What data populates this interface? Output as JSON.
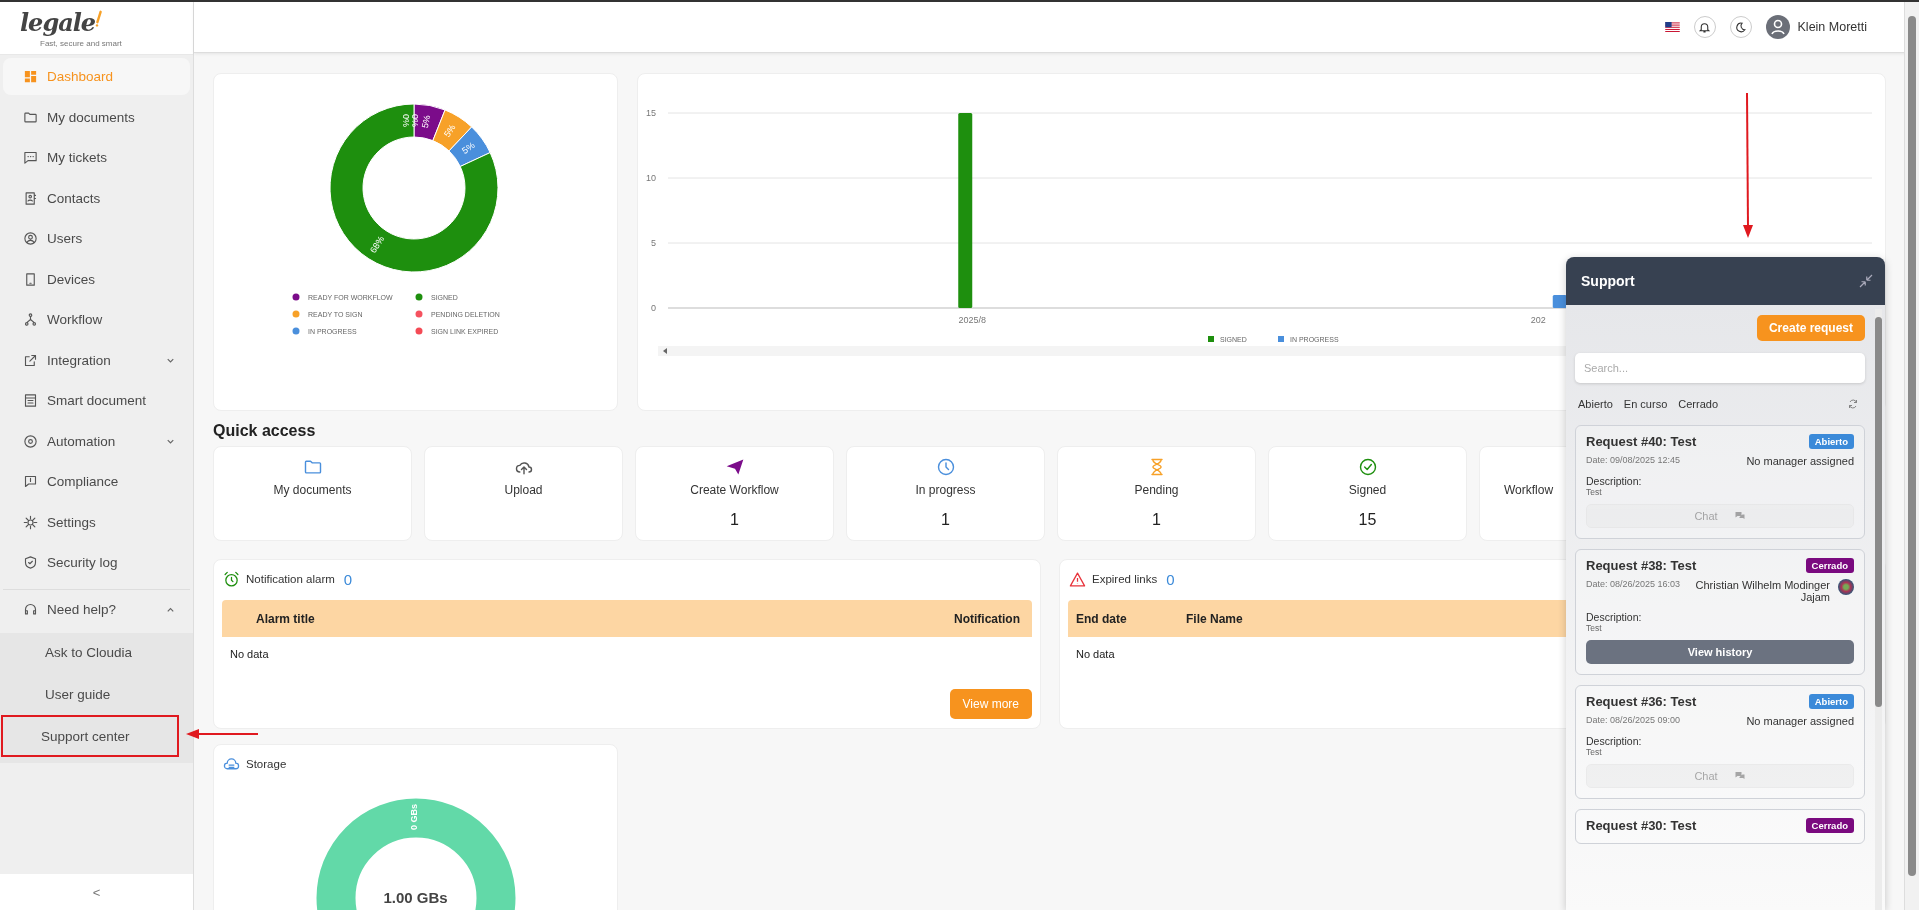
{
  "sidebar": {
    "logo": {
      "wordmark": "legale",
      "tagline": "Fast, secure and smart"
    },
    "items": [
      {
        "label": "Dashboard",
        "selected": true
      },
      {
        "label": "My documents",
        "selected": false
      },
      {
        "label": "My tickets",
        "selected": false
      },
      {
        "label": "Contacts",
        "selected": false
      },
      {
        "label": "Users",
        "selected": false
      },
      {
        "label": "Devices",
        "selected": false
      },
      {
        "label": "Workflow",
        "selected": false
      },
      {
        "label": "Integration",
        "selected": false,
        "expanded": false
      },
      {
        "label": "Smart document",
        "selected": false
      },
      {
        "label": "Automation",
        "selected": false,
        "expanded": false
      },
      {
        "label": "Compliance",
        "selected": false
      },
      {
        "label": "Settings",
        "selected": false
      },
      {
        "label": "Security log",
        "selected": false
      },
      {
        "label": "Need help?",
        "selected": false,
        "expanded": true,
        "children": [
          {
            "label": "Ask to Cloudia",
            "selected": false,
            "annotated": false
          },
          {
            "label": "User guide",
            "selected": false,
            "annotated": false
          },
          {
            "label": "Support center",
            "selected": false,
            "annotated": true
          }
        ]
      }
    ],
    "collapse": "<"
  },
  "header": {
    "user_name": "Klein Moretti"
  },
  "status_chart": {
    "chart_data": {
      "type": "donut",
      "categories": [
        "READY FOR WORKFLOW",
        "READY TO SIGN",
        "IN PROGRESS",
        "SIGNED",
        "PENDING DELETION",
        "SIGN LINK EXPIRED"
      ],
      "values": [
        5,
        5,
        5,
        68,
        0,
        0
      ],
      "colors": [
        "#7b0c8a",
        "#f7a128",
        "#4a8fdc",
        "#1e8f0e",
        "#f5525f",
        "#f44a55"
      ],
      "value_labels": [
        "5%",
        "5%",
        "5%",
        "68%",
        "0%",
        "0%"
      ],
      "legend": true
    }
  },
  "activity_chart": {
    "chart_data": {
      "type": "bar",
      "categories": [
        "2025/8",
        "202"
      ],
      "series": [
        {
          "name": "SIGNED",
          "color": "#1e8f0e",
          "values": [
            15,
            0
          ]
        },
        {
          "name": "IN PROGRESS",
          "color": "#4a8fdc",
          "values": [
            0,
            1
          ]
        }
      ],
      "ylim": [
        0,
        15
      ],
      "yticks": [
        0,
        5,
        10,
        15
      ],
      "legend": true
    }
  },
  "quick_access": {
    "title": "Quick access",
    "tiles": [
      {
        "label": "My documents",
        "icon": true
      },
      {
        "label": "Upload",
        "icon": true
      },
      {
        "label": "Create Workflow",
        "icon": true,
        "count": "1"
      },
      {
        "label": "In progress",
        "icon": true,
        "count": "1"
      },
      {
        "label": "Pending",
        "icon": true,
        "count": "1"
      },
      {
        "label": "Signed",
        "icon": true,
        "count": "15"
      },
      {
        "label": "Workflow",
        "icon": false
      }
    ]
  },
  "notification_alarm": {
    "title": "Notification alarm",
    "count": "0",
    "columns": [
      "Alarm title",
      "Notification"
    ],
    "empty": "No data",
    "button": "View more"
  },
  "expired_links": {
    "title": "Expired links",
    "count": "0",
    "columns": [
      "End date",
      "File Name"
    ],
    "empty": "No data"
  },
  "storage": {
    "title": "Storage",
    "total": "1.00 GBs",
    "used": "0 GBs"
  },
  "support": {
    "title": "Support",
    "create_button": "Create request",
    "search": {
      "placeholder": "Search..."
    },
    "filters": [
      {
        "label": "Abierto",
        "selected": false
      },
      {
        "label": "En curso",
        "selected": false
      },
      {
        "label": "Cerrado",
        "selected": false
      }
    ],
    "requests": [
      {
        "title": "Request #40: Test",
        "status": "Abierto",
        "color": "#3b8ad9",
        "date": "Date: 09/08/2025 12:45",
        "manager": "No manager assigned",
        "manager_avatar": false,
        "description_label": "Description:",
        "description": "Test",
        "action": {
          "label": "Chat",
          "kind": "chat",
          "disabled": true
        }
      },
      {
        "title": "Request #38: Test",
        "status": "Cerrado",
        "color": "#7a0a7f",
        "date": "Date: 08/26/2025 16:03",
        "manager": "Christian Wilhelm Modinger Jajam",
        "manager_avatar": true,
        "description_label": "Description:",
        "description": "Test",
        "action": {
          "label": "View history",
          "kind": "history",
          "disabled": false
        }
      },
      {
        "title": "Request #36: Test",
        "status": "Abierto",
        "color": "#3b8ad9",
        "date": "Date: 08/26/2025 09:00",
        "manager": "No manager assigned",
        "manager_avatar": false,
        "description_label": "Description:",
        "description": "Test",
        "action": {
          "label": "Chat",
          "kind": "chat",
          "disabled": true
        }
      },
      {
        "title": "Request #30: Test",
        "status": "Cerrado",
        "color": "#7a0a7f"
      }
    ]
  },
  "annotation_arrows": [
    {
      "kind": "down"
    },
    {
      "kind": "left"
    }
  ]
}
